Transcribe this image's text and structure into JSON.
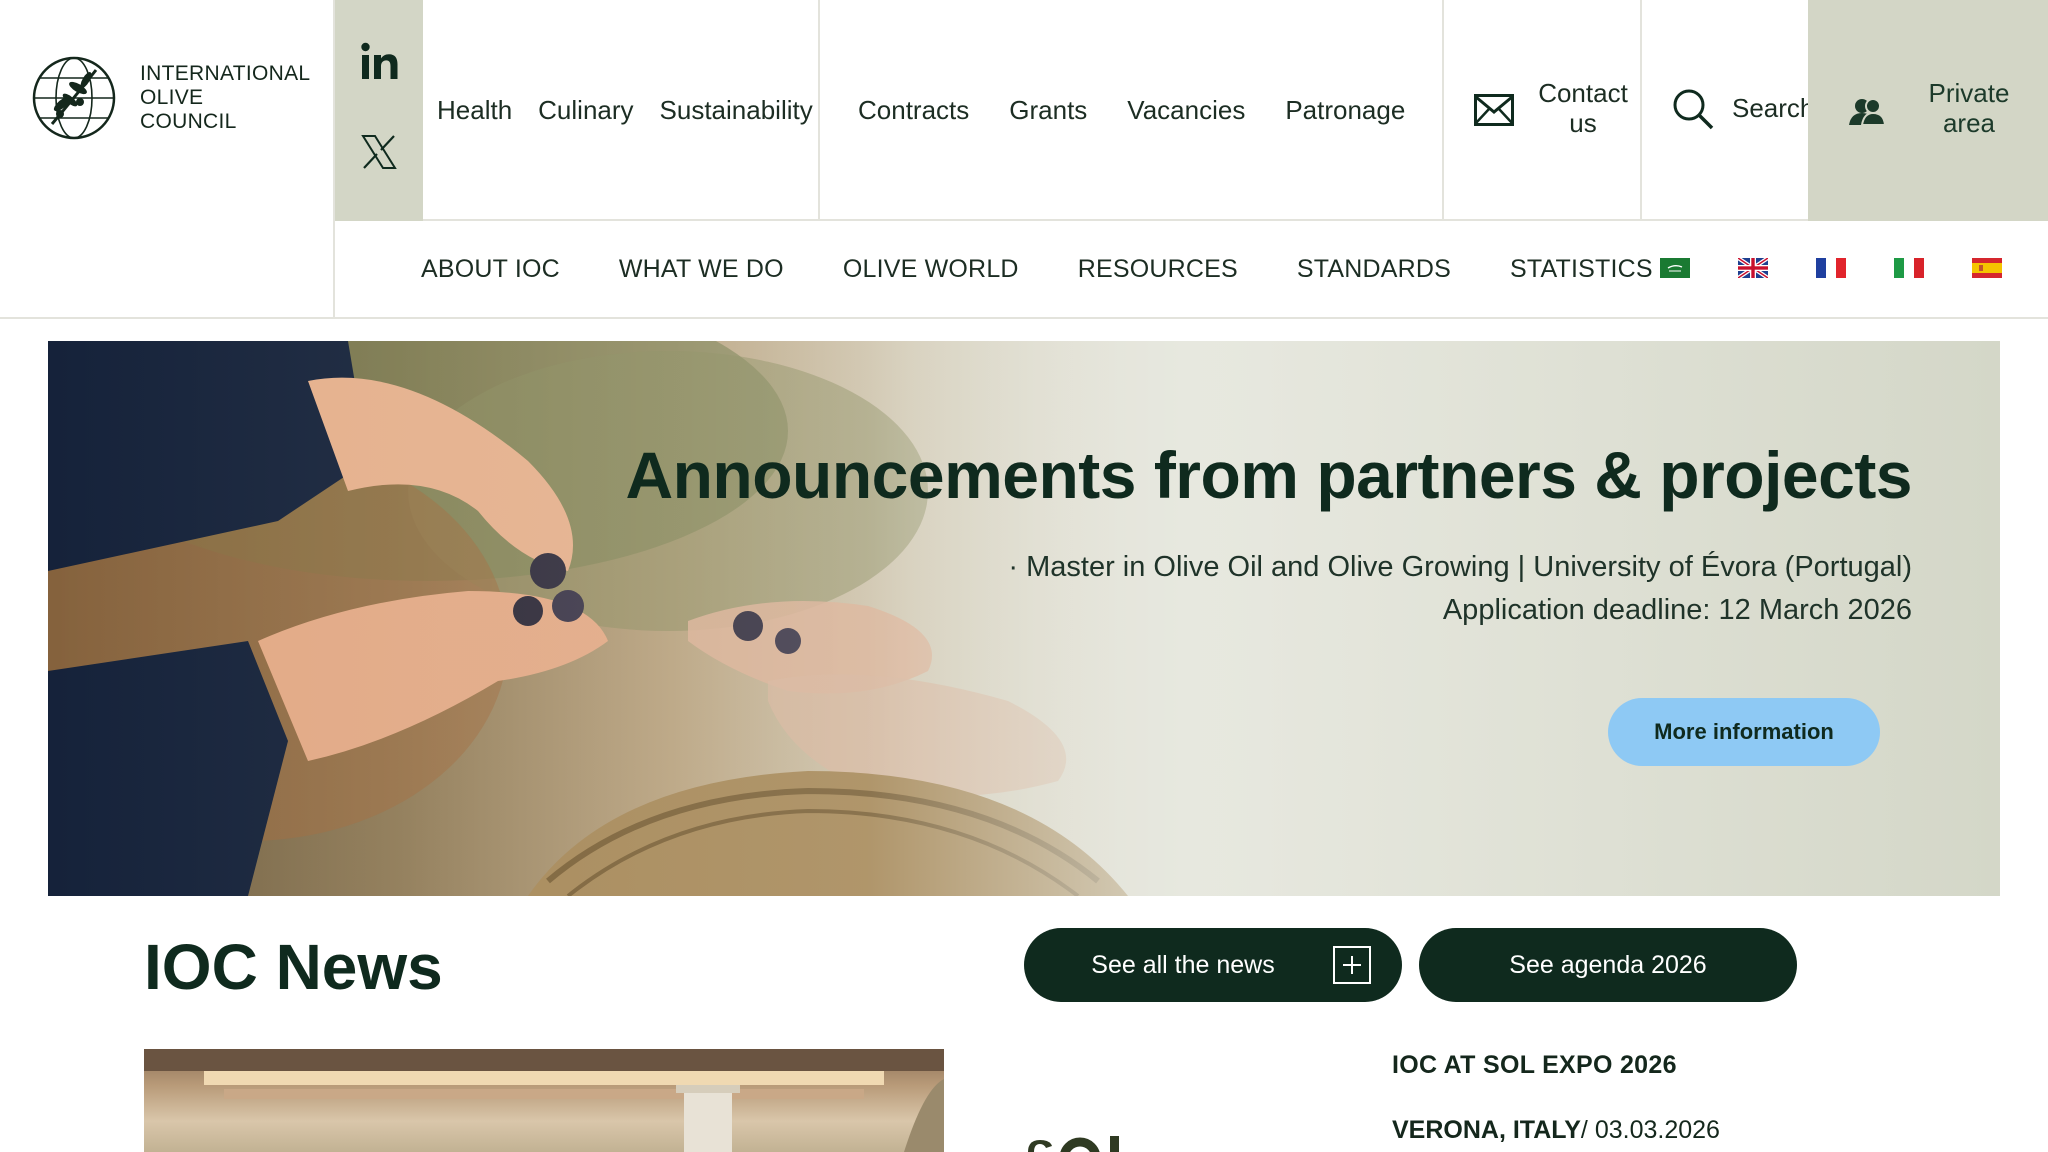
{
  "brand": {
    "line1": "INTERNATIONAL",
    "line2": "OLIVE",
    "line3": "COUNCIL"
  },
  "social": {
    "icons": [
      "linkedin-icon",
      "x-icon"
    ]
  },
  "topnav": {
    "group1": [
      "Health",
      "Culinary",
      "Sustainability"
    ],
    "group2": [
      "Contracts",
      "Grants",
      "Vacancies",
      "Patronage"
    ],
    "contact_line1": "Contact",
    "contact_line2": "us",
    "search_label": "Search",
    "private_line1": "Private",
    "private_line2": "area"
  },
  "mainnav": {
    "items": [
      "ABOUT IOC",
      "WHAT WE DO",
      "OLIVE WORLD",
      "RESOURCES",
      "STANDARDS",
      "STATISTICS"
    ],
    "languages": [
      "ar",
      "en",
      "fr",
      "it",
      "es"
    ]
  },
  "hero": {
    "title": "Announcements from partners & projects",
    "line1": "· Master in Olive Oil and Olive Growing | University of Évora (Portugal)",
    "line2": "Application deadline: 12 March 2026",
    "button": "More information"
  },
  "news": {
    "title": "IOC News",
    "see_all": "See all the news",
    "agenda": "See agenda 2026",
    "item": {
      "headline": "IOC AT SOL EXPO 2026",
      "location": "VERONA, ITALY",
      "date": "/ 03.03.2026"
    }
  },
  "colors": {
    "dark_green": "#0f2a1e",
    "sage": "#d3d6c6",
    "button_blue": "#8ec9f4"
  }
}
